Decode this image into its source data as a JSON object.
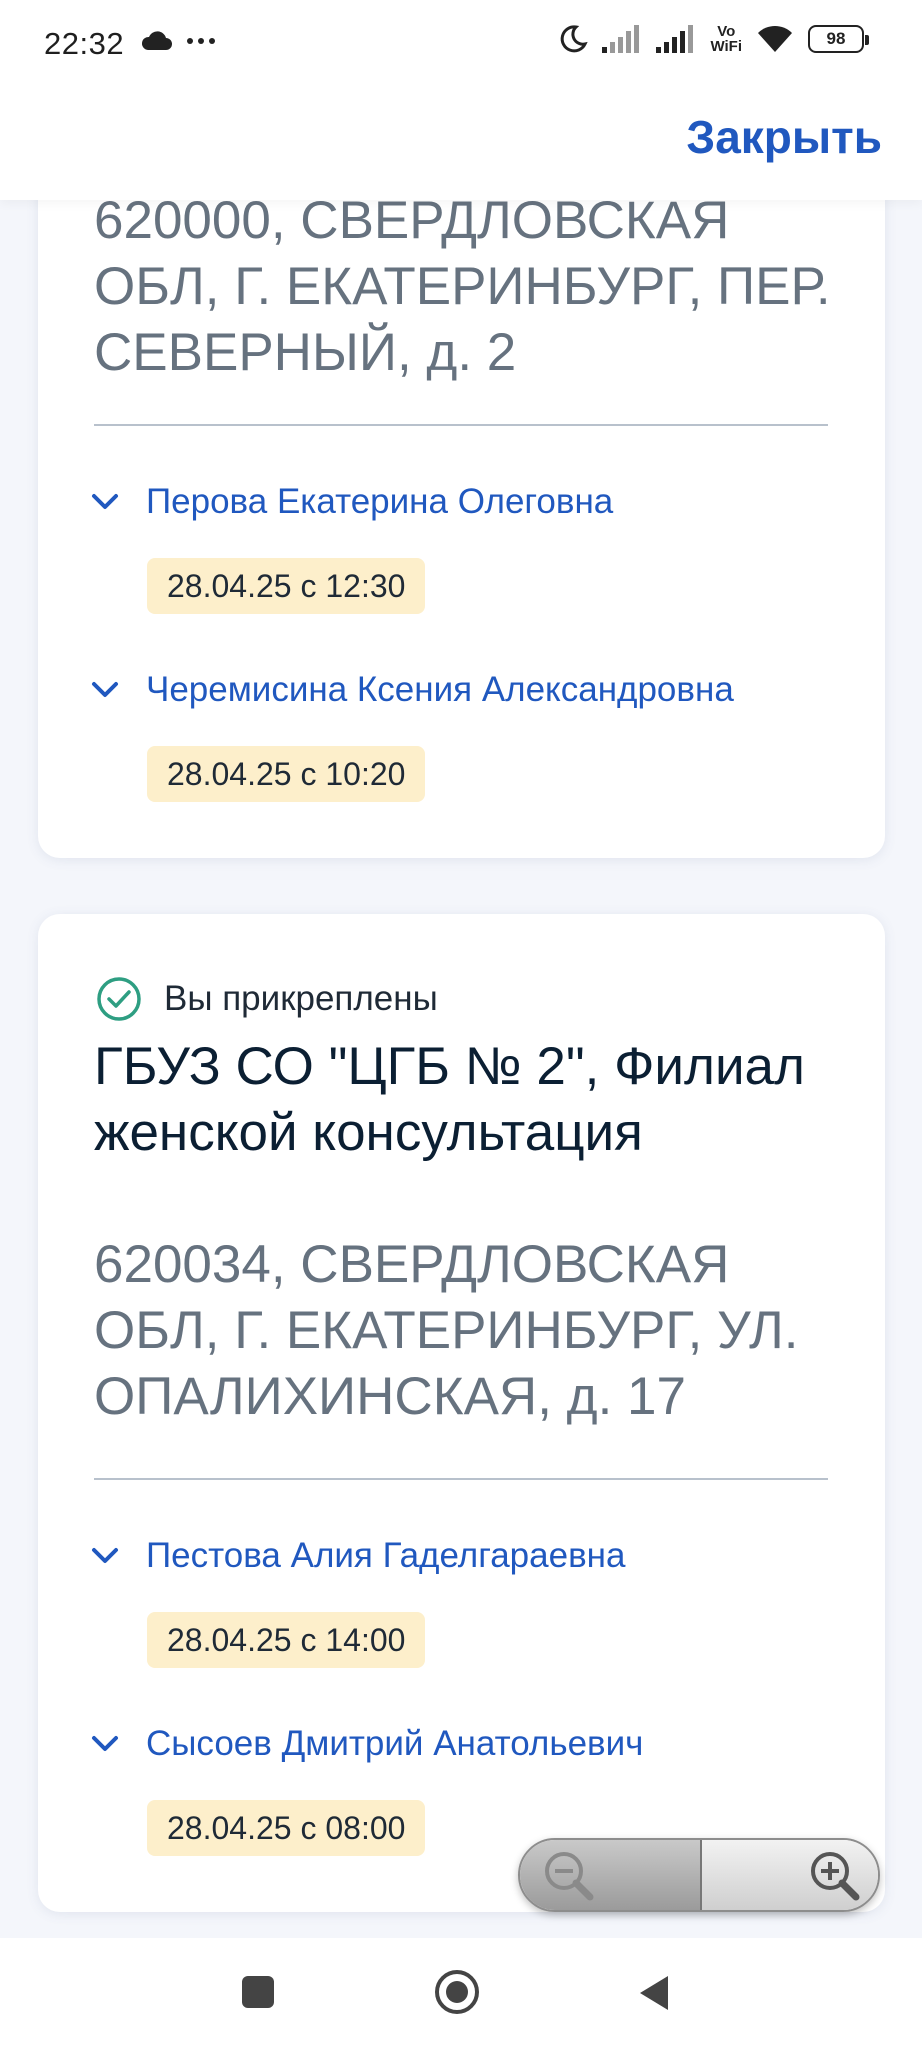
{
  "status_bar": {
    "time": "22:32",
    "battery": "98",
    "vowifi_top": "Vo",
    "vowifi_bottom": "WiFi",
    "left_icons": [
      "cloud-icon",
      "more-dots-icon"
    ],
    "right_icons": [
      "moon-icon",
      "signal-icon",
      "signal-icon",
      "vowifi-icon",
      "wifi-icon",
      "battery-icon"
    ]
  },
  "header": {
    "close_label": "Закрыть"
  },
  "colors": {
    "accent": "#2058bf",
    "address_gray": "#66727f",
    "badge_bg": "#fdefcb",
    "success": "#2e9e82"
  },
  "cards": [
    {
      "address": "620000, СВЕРДЛОВСКАЯ ОБЛ, Г. ЕКАТЕРИНБУРГ, ПЕР. СЕВЕРНЫЙ, д. 2",
      "doctors": [
        {
          "name": "Перова Екатерина Олеговна",
          "slot": "28.04.25 с 12:30"
        },
        {
          "name": "Черемисина Ксения Александровна",
          "slot": "28.04.25 с 10:20"
        }
      ]
    },
    {
      "attached_label": "Вы прикреплены",
      "clinic_name": "ГБУЗ СО \"ЦГБ № 2\", Филиал женской консультация",
      "address": "620034, СВЕРДЛОВСКАЯ ОБЛ, Г. ЕКАТЕРИНБУРГ, УЛ. ОПАЛИХИНСКАЯ, д. 17",
      "doctors": [
        {
          "name": "Пестова Алия Гаделгараевна",
          "slot": "28.04.25 с 14:00"
        },
        {
          "name": "Сысоев Дмитрий Анатольевич",
          "slot": "28.04.25 с 08:00"
        }
      ]
    }
  ],
  "zoom_controls": [
    "zoom-out-icon",
    "zoom-in-icon"
  ],
  "nav_bar": [
    "recent-apps-icon",
    "home-icon",
    "back-icon"
  ]
}
